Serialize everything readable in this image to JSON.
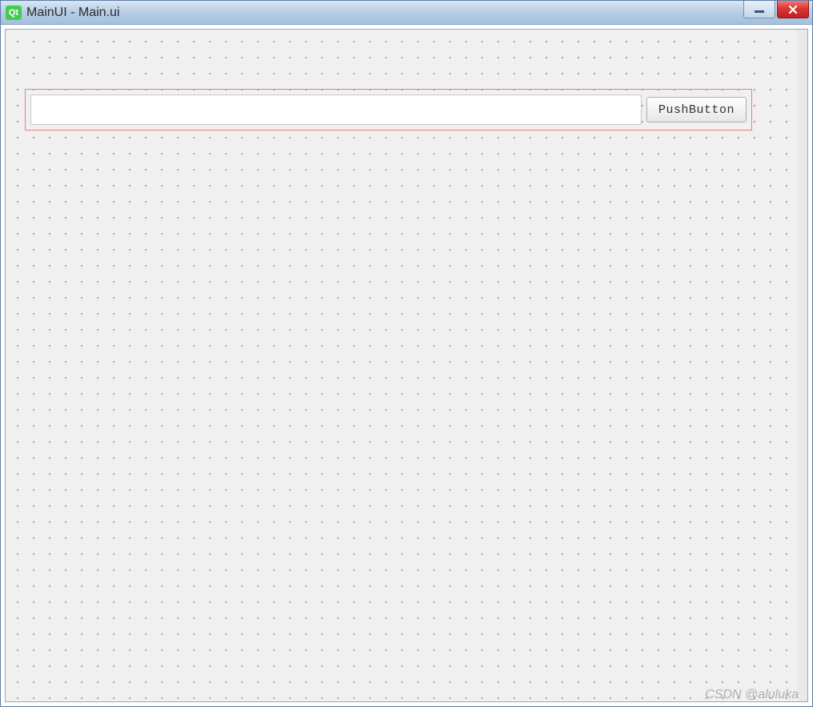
{
  "titlebar": {
    "icon_label": "Qt",
    "title": "MainUI - Main.ui"
  },
  "form": {
    "line_edit_value": "",
    "line_edit_placeholder": "",
    "push_button_label": "PushButton"
  },
  "watermark": "CSDN @aluluka"
}
